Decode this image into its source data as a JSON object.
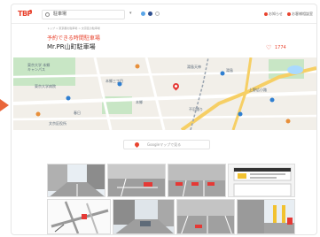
{
  "header": {
    "logo": "TBP",
    "search_value": "駐車場",
    "links": [
      "お知らせ",
      "お客様相談室"
    ]
  },
  "breadcrumb": "トップ > 東京都の駐車場 > 文京区の駐車場",
  "subtitle": "予約できる時間駐車場",
  "title": "Mr.PR山町駐車場",
  "favorites": "1774",
  "map": {
    "labels": [
      "東京大学 本郷",
      "キャンパス",
      "本郷三丁目",
      "東京大学病院",
      "湯島天神",
      "春日",
      "本郷",
      "上野広小路",
      "湯島",
      "不忍通り",
      "文京区役所"
    ]
  },
  "gmap_button": "Googleマップで見る",
  "colors": {
    "accent": "#e8432e",
    "outer_arrow": "#e9663a",
    "map_background": "#f2efe9",
    "map_road": "#ffffff",
    "map_highway": "#f6cf65",
    "map_park": "#c8e6c5",
    "map_water": "#aadaff",
    "map_transit": "#2f7fd1",
    "map_rail": "#9aa4b0",
    "street_pavement": "#9e9e9e",
    "parking_line": "#ffffff",
    "barrier": "#e53935",
    "building_wall": "#b0b0b0",
    "sky": "#e8eef3",
    "fence_yellow": "#f2c230"
  },
  "icons": {
    "search": "search-icon",
    "favorite": "heart-icon",
    "map_pin": "map-pin-icon"
  }
}
